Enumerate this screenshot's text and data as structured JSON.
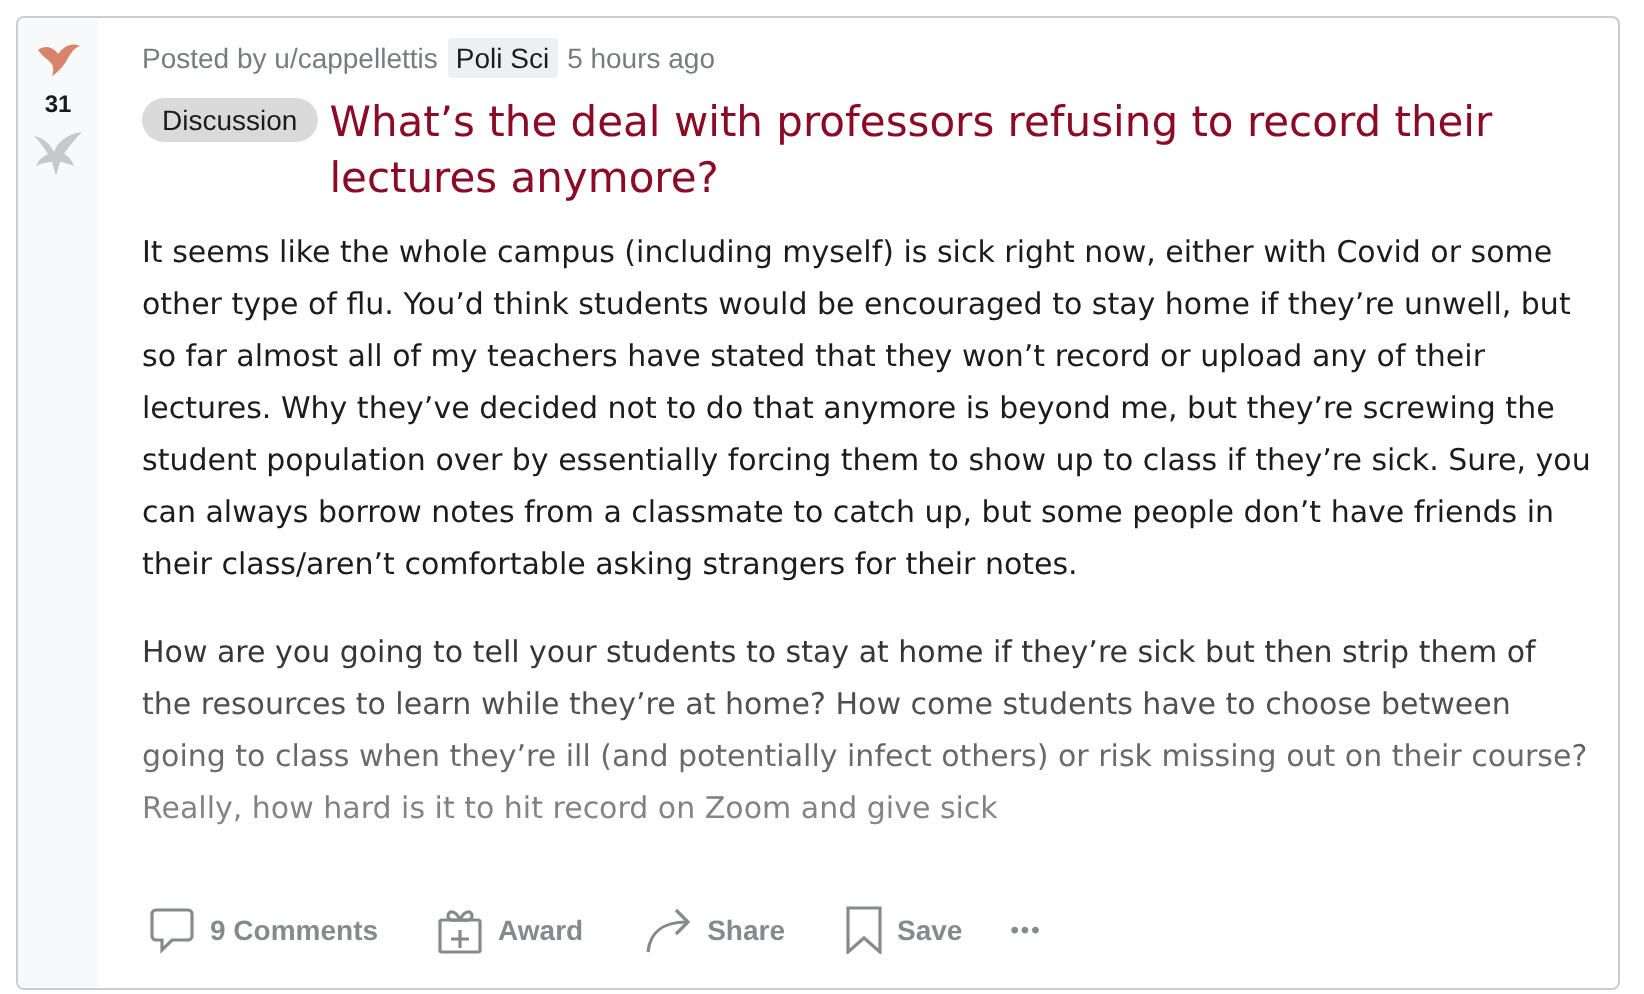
{
  "post": {
    "score": "31",
    "author": "Posted by u/cappellettis",
    "flair": "Poli Sci",
    "time": "5 hours ago",
    "tag": "Discussion",
    "title": "What’s the deal with professors refusing to record their lectures anymore?",
    "paragraphs": [
      "It seems like the whole campus (including myself) is sick right now, either with Covid or some other type of flu. You’d think students would be encouraged to stay home if they’re unwell, but so far almost all of my teachers have stated that they won’t record or upload any of their lectures. Why they’ve decided not to do that anymore is beyond me, but they’re screwing the student population over by essentially forcing them to show up to class if they’re sick. Sure, you can always borrow notes from a classmate to catch up, but some people don’t have friends in their class/aren’t comfortable asking strangers for their notes.",
      "How are you going to tell your students to stay at home if they’re sick but then strip them of the resources to learn while they’re at home? How come students have to choose between going to class when they’re ill (and potentially infect others) or risk missing out on their course? Really, how hard is it to hit record on Zoom and give sick"
    ]
  },
  "actions": [
    {
      "kind": "comments",
      "label": "9 Comments"
    },
    {
      "kind": "award",
      "label": "Award"
    },
    {
      "kind": "share",
      "label": "Share"
    },
    {
      "kind": "save",
      "label": "Save"
    },
    {
      "kind": "more",
      "label": "•••"
    }
  ]
}
